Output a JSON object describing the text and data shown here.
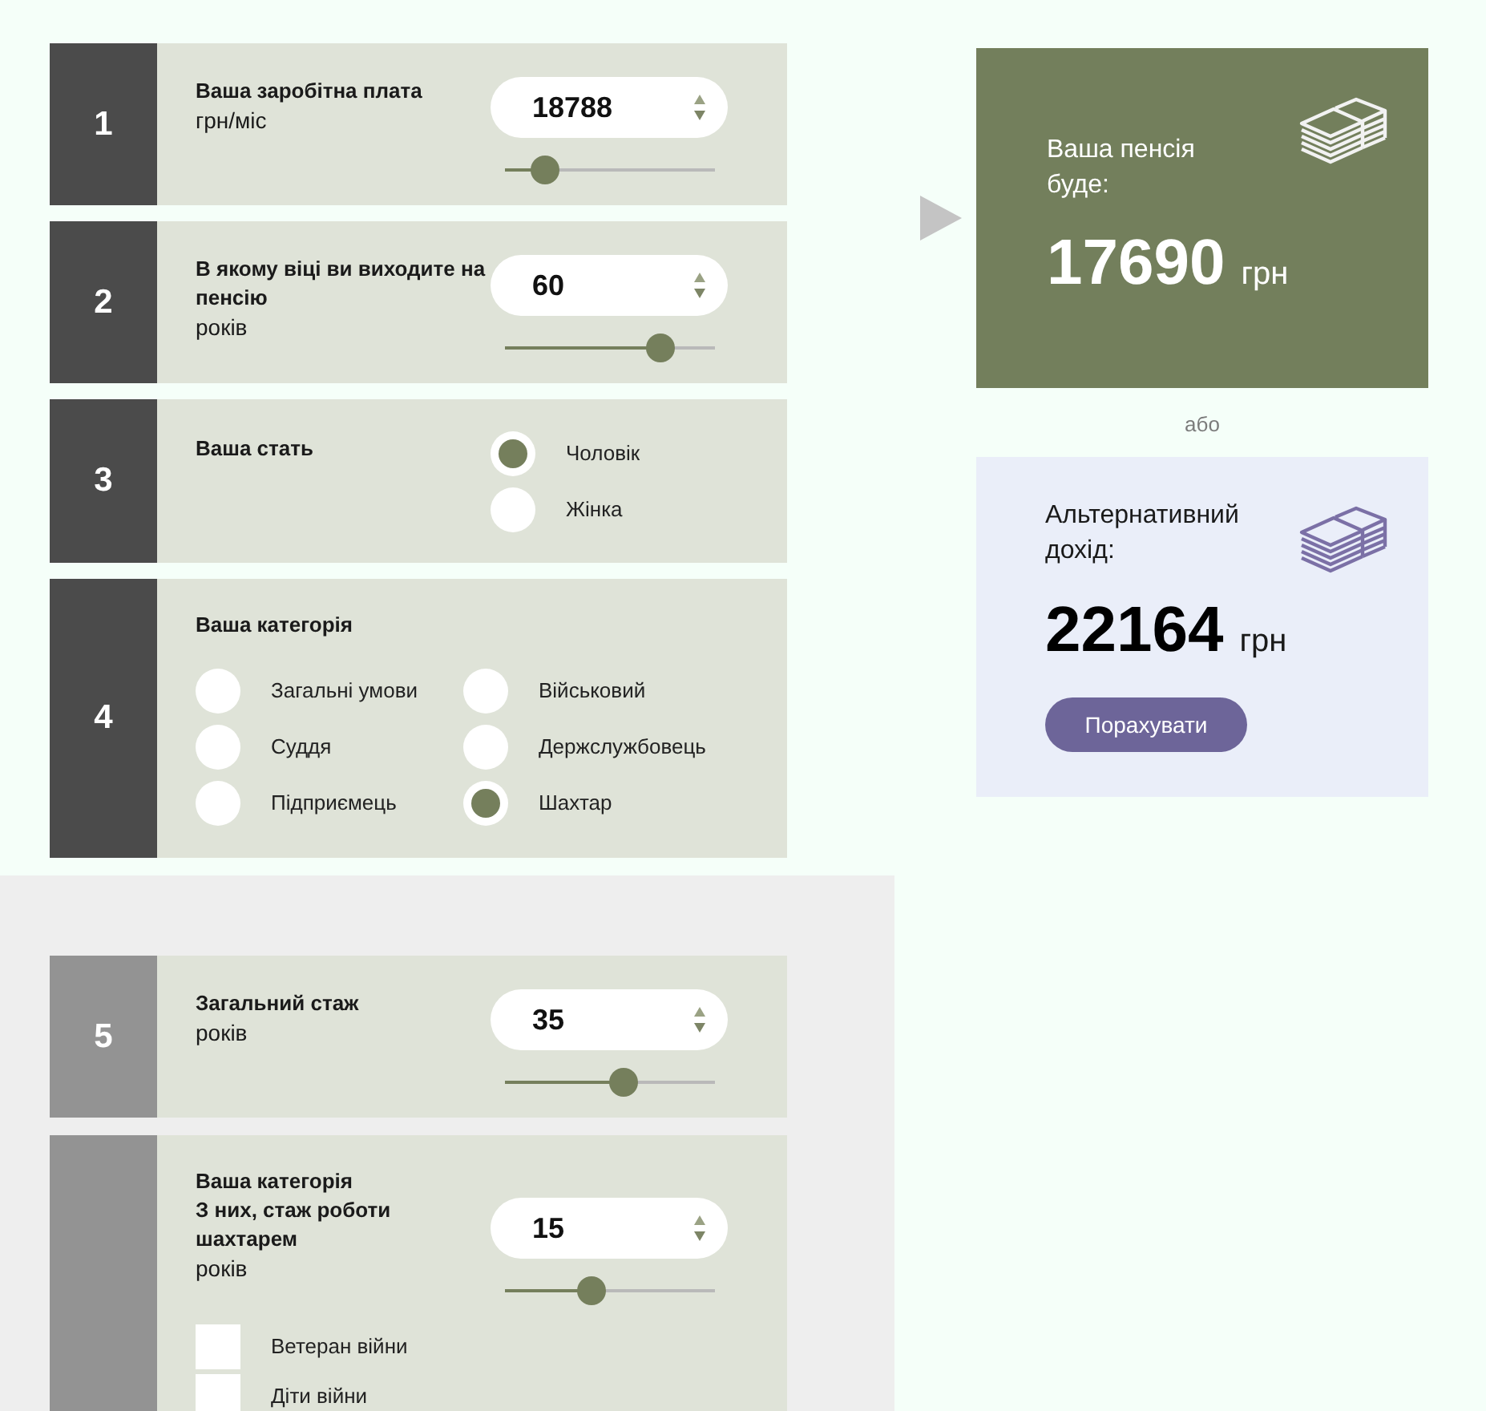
{
  "steps": [
    {
      "number": "1",
      "disabled": false,
      "kind": "number",
      "title": "Ваша заробітна плата",
      "unit": "грн/міс",
      "value": "18788",
      "level": 0.15
    },
    {
      "number": "2",
      "disabled": false,
      "kind": "number",
      "title": "В якому віці ви виходите на пенсію",
      "unit": "років",
      "value": "60",
      "level": 0.78
    },
    {
      "number": "3",
      "disabled": false,
      "kind": "radio",
      "title": "Ваша стать",
      "options": [
        {
          "label": "Чоловік",
          "selected": true
        },
        {
          "label": "Жінка",
          "selected": false
        }
      ]
    },
    {
      "number": "4",
      "disabled": false,
      "kind": "radio_grid",
      "title": "Ваша категорія",
      "options": [
        {
          "label": "Загальні умови",
          "selected": false
        },
        {
          "label": "Військовий",
          "selected": false
        },
        {
          "label": "Суддя",
          "selected": false
        },
        {
          "label": "Держслужбовець",
          "selected": false
        },
        {
          "label": "Підприємець",
          "selected": false
        },
        {
          "label": "Шахтар",
          "selected": true
        }
      ]
    }
  ],
  "pension_card": {
    "label": "Ваша пенсія буде:",
    "amount": "17690",
    "currency": "грн"
  },
  "separator": "або",
  "alternative_card": {
    "label": "Альтернативний дохід:",
    "amount": "22164",
    "currency": "грн",
    "button": "Порахувати"
  },
  "lower_section": {
    "steps": [
      {
        "number": "5",
        "disabled": true,
        "kind": "number",
        "title": "Загальний стаж",
        "unit": "років",
        "value": "35",
        "level": 0.58
      },
      {
        "disabled": true,
        "kind": "number_checks",
        "heading": "Ваша категорія",
        "title": "З них, стаж роботи шахтарем",
        "unit": "років",
        "value": "15",
        "level": 0.4,
        "checks": [
          {
            "label": "Ветеран війни",
            "checked": false
          },
          {
            "label": "Діти війни",
            "checked": false
          }
        ]
      }
    ]
  }
}
